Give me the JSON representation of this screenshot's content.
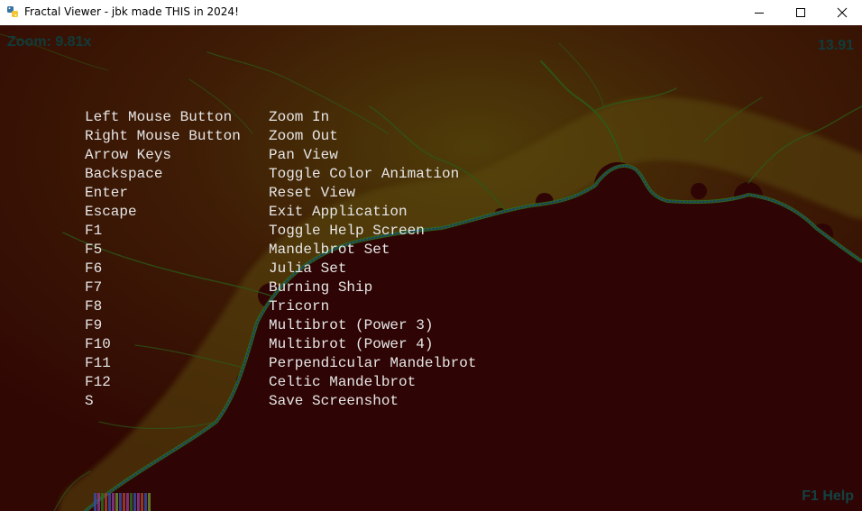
{
  "window": {
    "title": "Fractal Viewer - jbk made THIS in 2024!",
    "icon": "python-icon"
  },
  "overlay": {
    "zoom": "Zoom: 9.81x",
    "fps": "13.91",
    "help_hint": "F1 Help"
  },
  "help": {
    "rows": [
      {
        "key": "Left Mouse Button",
        "action": "Zoom In"
      },
      {
        "key": "Right Mouse Button",
        "action": "Zoom Out"
      },
      {
        "key": "Arrow Keys",
        "action": "Pan View"
      },
      {
        "key": "Backspace",
        "action": "Toggle Color Animation"
      },
      {
        "key": "Enter",
        "action": "Reset View"
      },
      {
        "key": "Escape",
        "action": "Exit Application"
      },
      {
        "key": "F1",
        "action": "Toggle Help Screen"
      },
      {
        "key": "F5",
        "action": "Mandelbrot Set"
      },
      {
        "key": "F6",
        "action": "Julia Set"
      },
      {
        "key": "F7",
        "action": "Burning Ship"
      },
      {
        "key": "F8",
        "action": "Tricorn"
      },
      {
        "key": "F9",
        "action": "Multibrot (Power 3)"
      },
      {
        "key": "F10",
        "action": "Multibrot (Power 4)"
      },
      {
        "key": "F11",
        "action": "Perpendicular Mandelbrot"
      },
      {
        "key": "F12",
        "action": "Celtic Mandelbrot"
      },
      {
        "key": "S",
        "action": "Save Screenshot"
      }
    ]
  },
  "colors": {
    "set_interior": "#2e0404",
    "background_outer": "#3a0a03",
    "glow": "#4a3a08",
    "filament_green": "#2e6a1a",
    "filament_blue": "#1a3a7a",
    "help_text": "#e6e6e6",
    "hud_text": "#0f3c3c"
  }
}
